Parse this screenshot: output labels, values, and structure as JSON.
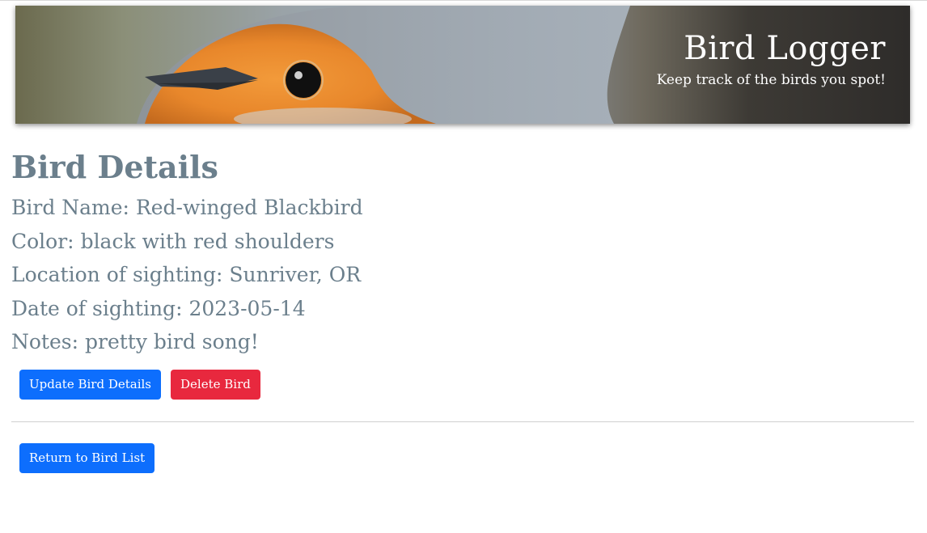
{
  "header": {
    "title": "Bird Logger",
    "subtitle": "Keep track of the birds you spot!"
  },
  "main": {
    "heading": "Bird Details",
    "details": {
      "name_label": "Bird Name:",
      "name_value": "Red-winged Blackbird",
      "color_label": "Color:",
      "color_value": "black with red shoulders",
      "location_label": "Location of sighting:",
      "location_value": "Sunriver, OR",
      "date_label": "Date of sighting:",
      "date_value": "2023-05-14",
      "notes_label": "Notes:",
      "notes_value": "pretty bird song!"
    },
    "actions": {
      "update_label": "Update Bird Details",
      "delete_label": "Delete Bird",
      "return_label": "Return to Bird List"
    }
  },
  "colors": {
    "primary": "#0d6efd",
    "danger": "#e8283e",
    "text": "#6b7f8c"
  },
  "icons": {
    "banner_image": "robin-photo"
  }
}
